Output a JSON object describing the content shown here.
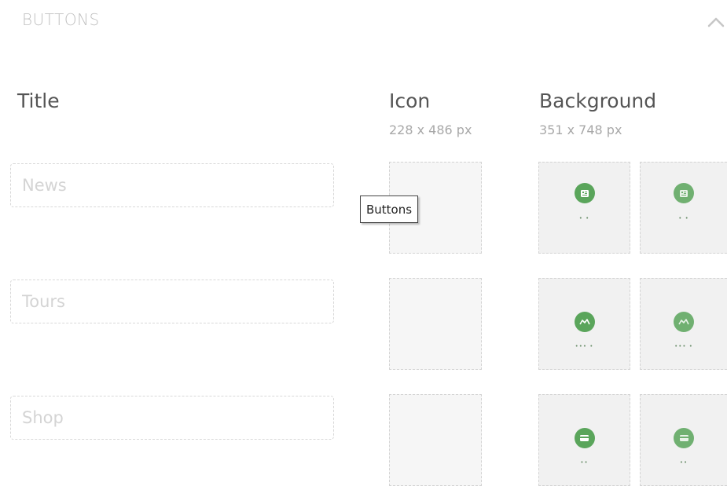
{
  "section": {
    "title": "BUTTONS",
    "toggle_icon": "chevron-up-icon"
  },
  "columns": {
    "title": {
      "label": "Title"
    },
    "icon": {
      "label": "Icon",
      "size": "228 x 486 px"
    },
    "background": {
      "label": "Background",
      "size": "351 x 748 px"
    }
  },
  "rows": [
    {
      "placeholder": "News",
      "bg_icon": "news-icon"
    },
    {
      "placeholder": "Tours",
      "bg_icon": "tours-icon"
    },
    {
      "placeholder": "Shop",
      "bg_icon": "shop-icon"
    }
  ],
  "tooltip": {
    "text": "Buttons"
  },
  "colors": {
    "accent_green": "#5aa55b",
    "muted_text": "#c0c0c0",
    "header_text": "#555555"
  }
}
